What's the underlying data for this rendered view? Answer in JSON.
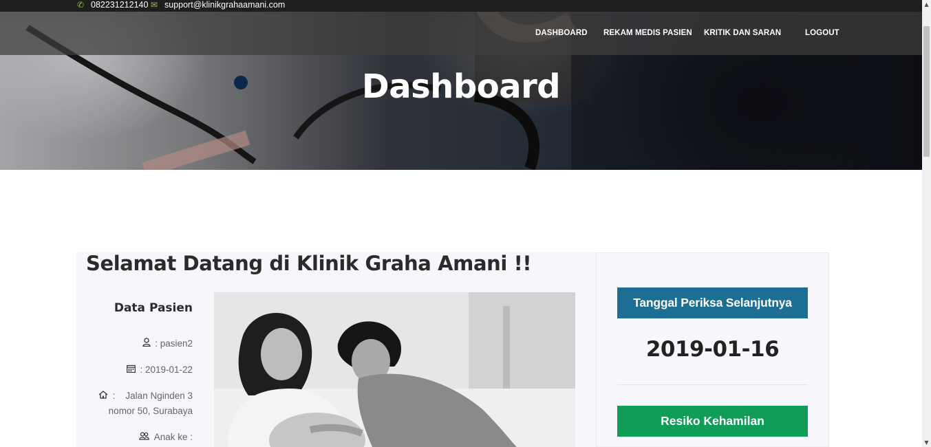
{
  "topbar": {
    "phone": "082231212140",
    "email": "support@klinikgrahaamani.com"
  },
  "nav": {
    "items": [
      "DASHBOARD",
      "REKAM MEDIS PASIEN",
      "KRITIK DAN SARAN",
      "LOGOUT"
    ]
  },
  "hero": {
    "title": "Dashboard"
  },
  "welcome": {
    "title": "Selamat Datang di Klinik Graha Amani !!"
  },
  "patient": {
    "heading": "Data Pasien",
    "username": ": pasien2",
    "date": ": 2019-01-22",
    "address_line1": ":    Jalan Nginden 3",
    "address_line2": "nomor 50, Surabaya",
    "children": "Anak ke :"
  },
  "sidebar": {
    "next_exam_label": "Tanggal Periksa Selanjutnya",
    "next_exam_date": "2019-01-16",
    "risk_label": "Resiko Kehamilan"
  },
  "colors": {
    "topbar_icon": "#8bc34a",
    "date_button": "#1c6e92",
    "risk_button": "#0f9d58"
  }
}
